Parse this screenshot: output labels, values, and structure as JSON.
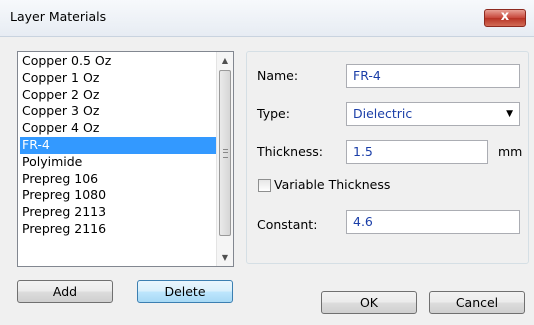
{
  "window": {
    "title": "Layer Materials",
    "close_glyph": "x"
  },
  "materials": {
    "items": [
      "Copper 0.5 Oz",
      "Copper 1 Oz",
      "Copper 2 Oz",
      "Copper 3 Oz",
      "Copper 4 Oz",
      "FR-4",
      "Polyimide",
      "Prepreg 106",
      "Prepreg 1080",
      "Prepreg 2113",
      "Prepreg 2116"
    ],
    "selected": "FR-4"
  },
  "buttons": {
    "add": "Add",
    "delete": "Delete",
    "ok": "OK",
    "cancel": "Cancel"
  },
  "properties": {
    "name_label": "Name:",
    "name_value": "FR-4",
    "type_label": "Type:",
    "type_value": "Dielectric",
    "thickness_label": "Thickness:",
    "thickness_value": "1.5",
    "thickness_unit": "mm",
    "variable_thickness_label": "Variable Thickness",
    "variable_thickness_checked": false,
    "constant_label": "Constant:",
    "constant_value": "4.6"
  },
  "colors": {
    "selection": "#3399ff",
    "field_text": "#1a3ea8",
    "close_button": "#c7463a"
  }
}
